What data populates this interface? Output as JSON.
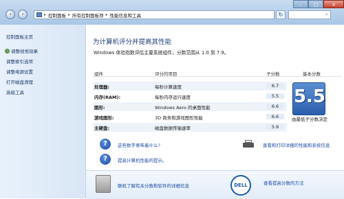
{
  "window": {
    "breadcrumb": [
      "控制面板",
      "所有控制面板项",
      "性能信息和工具"
    ],
    "search_icon": "search-icon",
    "buttons": {
      "minimize": "–",
      "maximize": "□",
      "close": "×"
    }
  },
  "sidebar": {
    "items": [
      {
        "label": "控制面板主页"
      },
      {
        "label": "调整视觉效果"
      },
      {
        "label": "调整索引选项"
      },
      {
        "label": "调整电源设置"
      },
      {
        "label": "打开磁盘清理"
      },
      {
        "label": "高级工具"
      }
    ]
  },
  "main": {
    "heading": "为计算机评分并提高其性能",
    "description": "Windows 体验指数评估主要系统组件，分数范围从 1.0 到 7.9。",
    "table": {
      "headers": {
        "component": "组件",
        "rated_item": "评分的项目",
        "subscore": "子分数",
        "base_score": "基本分数"
      },
      "rows": [
        {
          "component": "处理器:",
          "item": "每秒计算速度",
          "score": "6.7"
        },
        {
          "component": "内存(RAM):",
          "item": "每秒内存运行速度",
          "score": "5.5"
        },
        {
          "component": "图形:",
          "item": "Windows Aero 的桌面性能",
          "score": "6.6"
        },
        {
          "component": "游戏图形:",
          "item": "3D 商务和游戏图形性能",
          "score": "6.6"
        },
        {
          "component": "主硬盘:",
          "item": "磁盘数据传输速率",
          "score": "5.9"
        }
      ],
      "base_score": "5.5",
      "base_caption": "由最低子分数决定"
    },
    "links": {
      "what_mean": "这些数字意味着什么?",
      "tips": "提高计算机性能的提示。",
      "print": "查看和打印详细的性能和系统信息",
      "learn_more": "联机了解有关分数和软件的详细信息",
      "offers": "查看提高分数的方法"
    },
    "dell_logo": "DELL"
  }
}
